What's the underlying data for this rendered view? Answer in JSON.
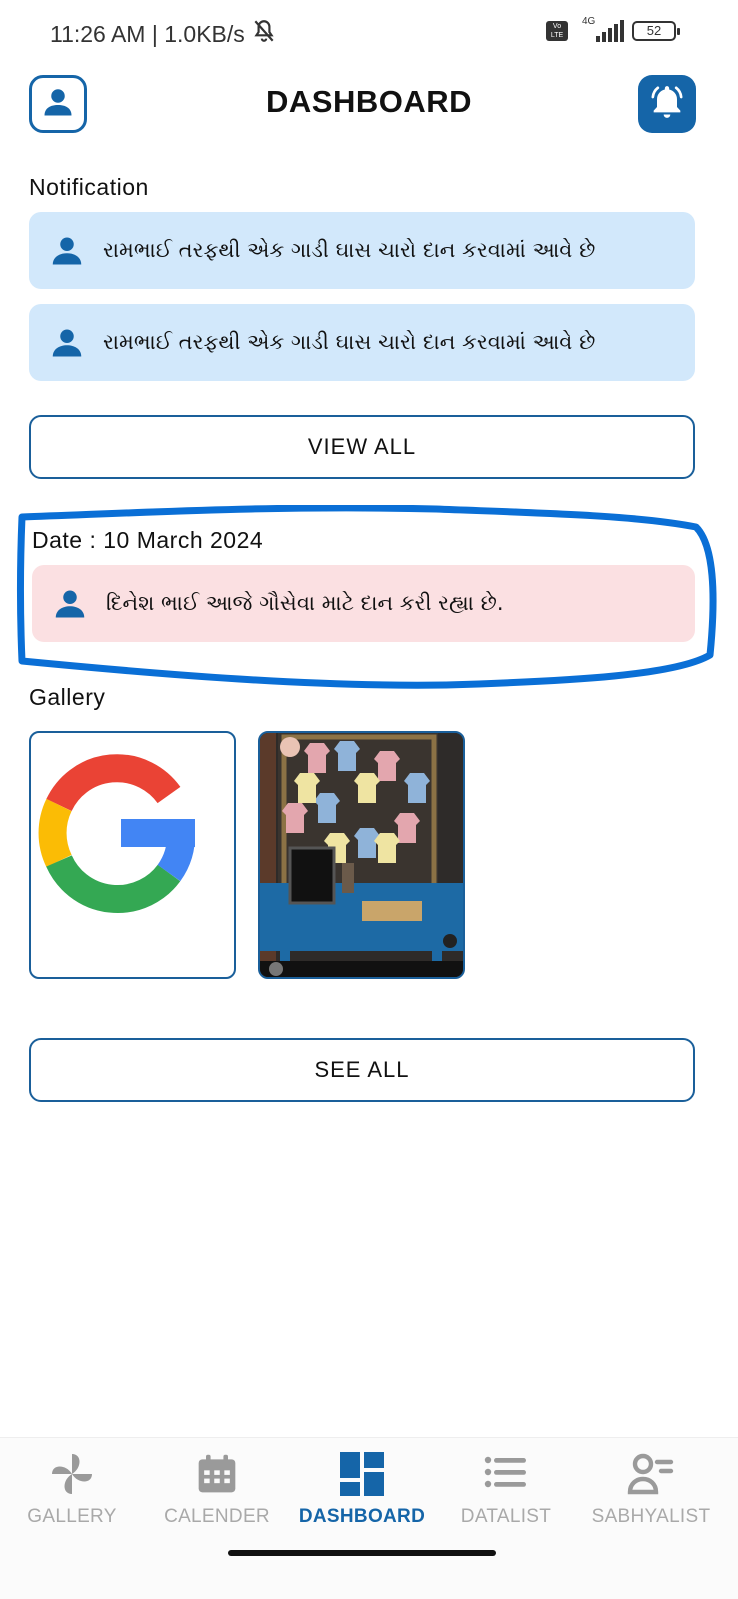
{
  "status_bar": {
    "time_speed": "11:26 AM | 1.0KB/s",
    "network": "4G",
    "volte": "Vo\nLTE",
    "battery": "52"
  },
  "header": {
    "title": "DASHBOARD",
    "profile_icon": "profile-icon",
    "bell_icon": "bell-icon"
  },
  "notification_section": {
    "title": "Notification",
    "items": [
      {
        "text": "રામભાઈ તરફથી એક ગાડી ઘાસ ચારો દાન કરવામાં આવે છે"
      },
      {
        "text": "રામભાઈ તરફથી એક ગાડી ઘાસ ચારો દાન કરવામાં આવે છે"
      }
    ],
    "view_all_label": "VIEW ALL"
  },
  "date_section": {
    "label": "Date : 10 March 2024",
    "item_text": "દિનેશ ભાઈ આજે ગૌસેવા માટે દાન કરી રહ્યા છે."
  },
  "gallery_section": {
    "title": "Gallery",
    "images": [
      "google-logo",
      "photo-display"
    ],
    "see_all_label": "SEE ALL"
  },
  "bottom_nav": {
    "items": [
      {
        "label": "GALLERY",
        "icon": "pinwheel-icon",
        "active": false
      },
      {
        "label": "CALENDER",
        "icon": "calendar-icon",
        "active": false
      },
      {
        "label": "DASHBOARD",
        "icon": "dashboard-icon",
        "active": true
      },
      {
        "label": "DATALIST",
        "icon": "list-icon",
        "active": false
      },
      {
        "label": "SABHYALIST",
        "icon": "person-list-icon",
        "active": false
      }
    ]
  },
  "colors": {
    "primary": "#1565a8",
    "notification_bg": "#d2e8fb",
    "highlight_bg": "#fbe0e2",
    "annotation_stroke": "#0a6fd6",
    "inactive_nav": "#a9a9a9"
  }
}
